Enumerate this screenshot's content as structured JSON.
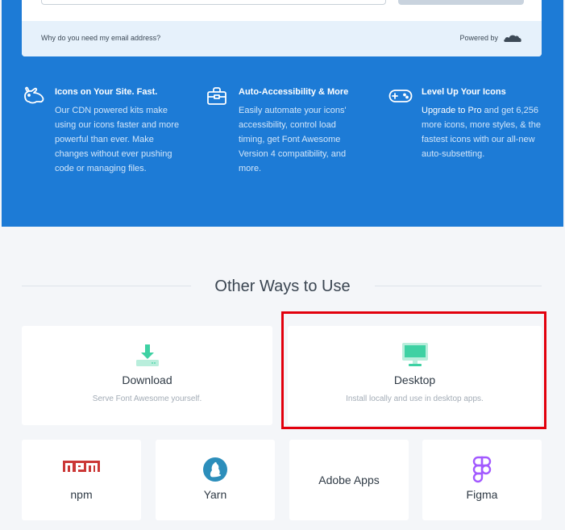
{
  "email_card": {
    "why_link": "Why do you need my email address?",
    "powered_by": "Powered by"
  },
  "features": [
    {
      "title": "Icons on Your Site. Fast.",
      "icon": "rabbit-icon",
      "text": "Our CDN powered kits make using our icons faster and more powerful than ever. Make changes without ever pushing code or managing files."
    },
    {
      "title": "Auto-Accessibility & More",
      "icon": "toolbox-icon",
      "text": "Easily automate your icons' accessibility, control load timing, get Font Awesome Version 4 compatibility, and more."
    },
    {
      "title": "Level Up Your Icons",
      "icon": "gamepad-icon",
      "link": "Upgrade to Pro",
      "text": " and get 6,256 more icons, more styles, & the fastest icons with our all-new auto-subsetting."
    }
  ],
  "other_ways": {
    "title": "Other Ways to Use",
    "big_cards": [
      {
        "title": "Download",
        "sub": "Serve Font Awesome yourself.",
        "icon": "download-icon"
      },
      {
        "title": "Desktop",
        "sub": "Install locally and use in desktop apps.",
        "icon": "desktop-icon"
      }
    ],
    "small_cards": [
      {
        "title": "npm",
        "icon": "npm-logo-icon"
      },
      {
        "title": "Yarn",
        "icon": "yarn-logo-icon"
      },
      {
        "title": "Adobe Apps",
        "icon": ""
      },
      {
        "title": "Figma",
        "icon": "figma-logo-icon"
      }
    ]
  },
  "colors": {
    "hero_blue": "#1d7bd6",
    "accent_green": "#3ed1a3",
    "npm_red": "#cb3837",
    "yarn_blue": "#2c8ebb",
    "figma_purple": "#a259ff",
    "highlight_red": "#e2000d"
  }
}
